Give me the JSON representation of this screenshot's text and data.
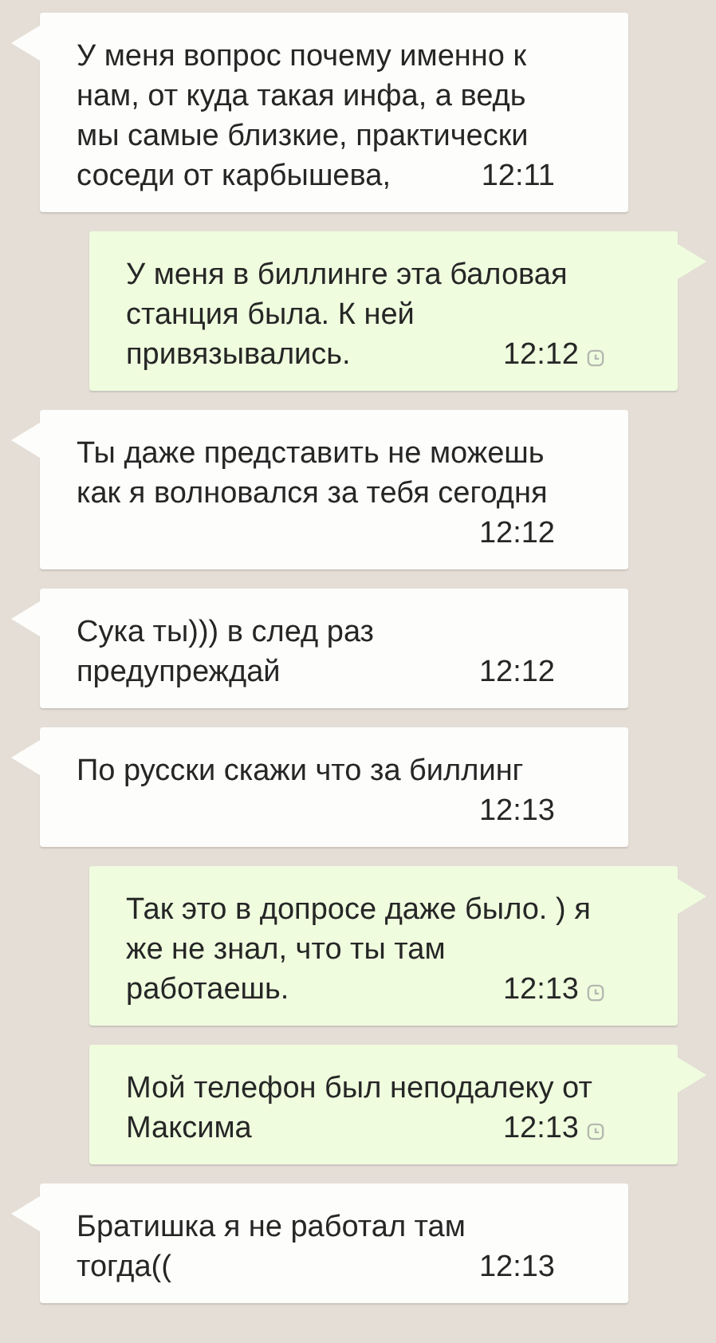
{
  "messages": [
    {
      "outgoing": false,
      "text": "У меня вопрос почему именно к нам, от куда такая инфа, а ведь мы самые близкие, практически соседи от карбышева,",
      "time": "12:11"
    },
    {
      "outgoing": true,
      "text": "У меня в биллинге эта баловая станция была. К ней привязывались.",
      "time": "12:12",
      "pending": true
    },
    {
      "outgoing": false,
      "text": "Ты даже представить не можешь как я волновался за тебя сегодня",
      "time": "12:12"
    },
    {
      "outgoing": false,
      "text": "Сука ты))) в след раз предупреждай",
      "time": "12:12"
    },
    {
      "outgoing": false,
      "text": "По русски скажи что за биллинг",
      "time": "12:13"
    },
    {
      "outgoing": true,
      "text": "Так это в допросе даже было. ) я же не знал, что ты там работаешь.",
      "time": "12:13",
      "pending": true
    },
    {
      "outgoing": true,
      "text": "Мой телефон был неподалеку от Максима",
      "time": "12:13",
      "pending": true
    },
    {
      "outgoing": false,
      "text": "Братишка я не работал там тогда((",
      "time": "12:13"
    }
  ]
}
